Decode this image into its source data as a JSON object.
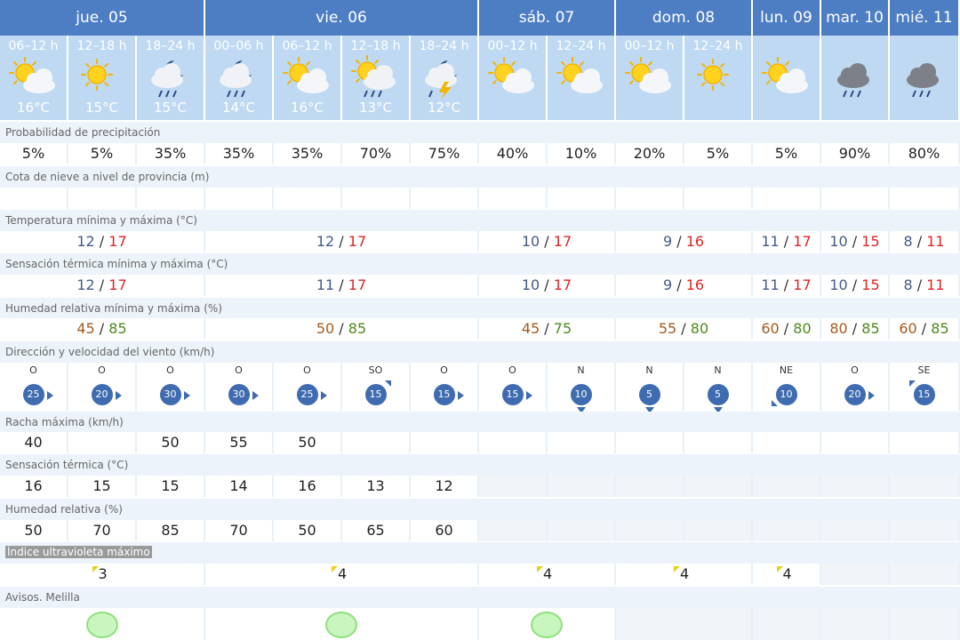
{
  "days": [
    {
      "label": "jue. 05"
    },
    {
      "label": "vie. 06"
    },
    {
      "label": "sáb. 07"
    },
    {
      "label": "dom. 08"
    },
    {
      "label": "lun. 09"
    },
    {
      "label": "mar. 10"
    },
    {
      "label": "mié. 11"
    }
  ],
  "periods": [
    {
      "label": "06–12 h",
      "icon": "sun-cloud-icon",
      "temp": "16°C"
    },
    {
      "label": "12–18 h",
      "icon": "sun-icon",
      "temp": "15°C"
    },
    {
      "label": "18–24 h",
      "icon": "moon-cloud-rain-icon",
      "temp": "15°C"
    },
    {
      "label": "00–06 h",
      "icon": "moon-cloud-rain-icon",
      "temp": "14°C"
    },
    {
      "label": "06–12 h",
      "icon": "sun-cloud-icon",
      "temp": "16°C"
    },
    {
      "label": "12–18 h",
      "icon": "sun-cloud-rain-icon",
      "temp": "13°C"
    },
    {
      "label": "18–24 h",
      "icon": "moon-cloud-storm-icon",
      "temp": "12°C"
    },
    {
      "label": "00–12 h",
      "icon": "sun-cloud-icon",
      "temp": ""
    },
    {
      "label": "12–24 h",
      "icon": "sun-cloud-icon",
      "temp": ""
    },
    {
      "label": "00–12 h",
      "icon": "sun-cloud-icon",
      "temp": ""
    },
    {
      "label": "12–24 h",
      "icon": "sun-icon",
      "temp": ""
    },
    {
      "label": "",
      "icon": "sun-cloud-icon",
      "temp": ""
    },
    {
      "label": "",
      "icon": "rain-cloud-icon",
      "temp": ""
    },
    {
      "label": "",
      "icon": "rain-cloud-icon",
      "temp": ""
    }
  ],
  "labels": {
    "precip": "Probabilidad de precipitación",
    "snow": "Cota de nieve a nivel de provincia (m)",
    "temp": "Temperatura mínima y máxima (°C)",
    "feels": "Sensación térmica mínima y máxima (°C)",
    "hum": "Humedad relativa mínima y máxima (%)",
    "wind": "Dirección y velocidad del viento (km/h)",
    "gust": "Racha máxima (km/h)",
    "feels_p": "Sensación térmica (°C)",
    "hum_p": "Humedad relativa (%)",
    "uv": "Índice ultravioleta máximo",
    "avisos": "Avisos. Melilla"
  },
  "precip": [
    "5%",
    "5%",
    "35%",
    "35%",
    "35%",
    "70%",
    "75%",
    "40%",
    "10%",
    "20%",
    "5%",
    "5%",
    "90%",
    "80%"
  ],
  "temps": [
    {
      "min": "12",
      "max": "17"
    },
    {
      "min": "12",
      "max": "17"
    },
    {
      "min": "10",
      "max": "17"
    },
    {
      "min": "9",
      "max": "16"
    },
    {
      "min": "11",
      "max": "17"
    },
    {
      "min": "10",
      "max": "15"
    },
    {
      "min": "8",
      "max": "11"
    }
  ],
  "feels": [
    {
      "min": "12",
      "max": "17"
    },
    {
      "min": "11",
      "max": "17"
    },
    {
      "min": "10",
      "max": "17"
    },
    {
      "min": "9",
      "max": "16"
    },
    {
      "min": "11",
      "max": "17"
    },
    {
      "min": "10",
      "max": "15"
    },
    {
      "min": "8",
      "max": "11"
    }
  ],
  "humidity": [
    {
      "min": "45",
      "max": "85"
    },
    {
      "min": "50",
      "max": "85"
    },
    {
      "min": "45",
      "max": "75"
    },
    {
      "min": "55",
      "max": "80"
    },
    {
      "min": "60",
      "max": "80"
    },
    {
      "min": "80",
      "max": "85"
    },
    {
      "min": "60",
      "max": "85"
    }
  ],
  "wind": [
    {
      "dir": "O",
      "speed": "25"
    },
    {
      "dir": "O",
      "speed": "20"
    },
    {
      "dir": "O",
      "speed": "30"
    },
    {
      "dir": "O",
      "speed": "30"
    },
    {
      "dir": "O",
      "speed": "25"
    },
    {
      "dir": "SO",
      "speed": "15"
    },
    {
      "dir": "O",
      "speed": "15"
    },
    {
      "dir": "O",
      "speed": "15"
    },
    {
      "dir": "N",
      "speed": "10"
    },
    {
      "dir": "N",
      "speed": "5"
    },
    {
      "dir": "N",
      "speed": "5"
    },
    {
      "dir": "NE",
      "speed": "10"
    },
    {
      "dir": "O",
      "speed": "20"
    },
    {
      "dir": "SE",
      "speed": "15"
    }
  ],
  "gust": [
    "40",
    "",
    "50",
    "55",
    "50",
    "",
    "",
    "",
    "",
    "",
    "",
    "",
    "",
    ""
  ],
  "feels_period": [
    "16",
    "15",
    "15",
    "14",
    "16",
    "13",
    "12"
  ],
  "hum_period": [
    "50",
    "70",
    "85",
    "70",
    "50",
    "65",
    "60"
  ],
  "uv": [
    "3",
    "4",
    "4",
    "4",
    "4",
    "",
    ""
  ],
  "avisos": [
    "green",
    "green",
    "green",
    "",
    "",
    "",
    ""
  ],
  "colors": {
    "header": "#4d7ec4",
    "period_bg": "#bed9f1",
    "label_bg": "#edf3fa",
    "tmin": "#445a88",
    "tmax": "#e02323",
    "aviso_green": "#c9f5bf"
  }
}
